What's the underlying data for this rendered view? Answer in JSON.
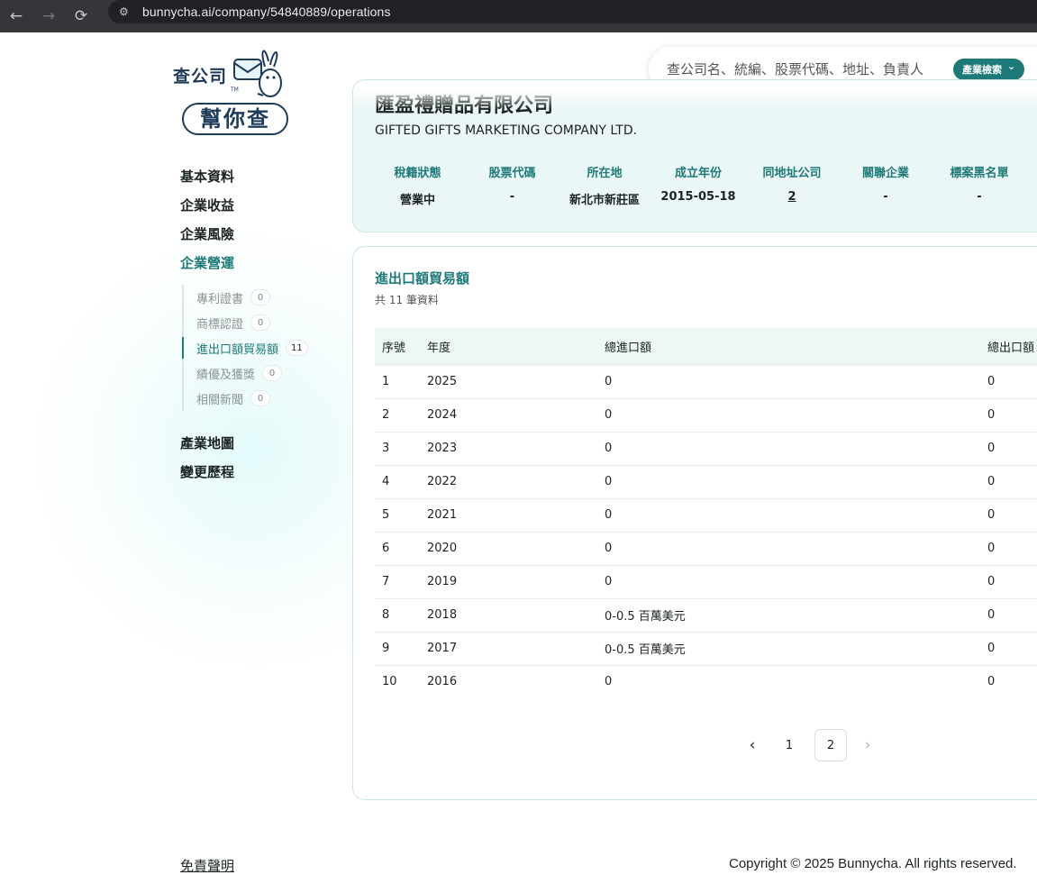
{
  "browser": {
    "url": "bunnycha.ai/company/54840889/operations",
    "back_icon": "←",
    "forward_icon": "→",
    "reload_icon": "⟳",
    "site_icon": "⚙"
  },
  "logo": {
    "wordmark": "查公司",
    "tagline": "幫你查",
    "tm": "TM"
  },
  "search": {
    "placeholder": "查公司名、統編、股票代碼、地址、負責人",
    "type_label": "產業檢索",
    "chevron": "⌄"
  },
  "sidebar": {
    "main_items": [
      {
        "label": "基本資料"
      },
      {
        "label": "企業收益"
      },
      {
        "label": "企業風險"
      },
      {
        "label": "企業營運"
      }
    ],
    "sub_items": [
      {
        "label": "專利證書",
        "count": "0"
      },
      {
        "label": "商標認證",
        "count": "0"
      },
      {
        "label": "進出口額貿易額",
        "count": "11"
      },
      {
        "label": "績優及獲獎",
        "count": "0"
      },
      {
        "label": "相關新聞",
        "count": "0"
      }
    ],
    "bottom_items": [
      {
        "label": "產業地圖"
      },
      {
        "label": "變更歷程"
      }
    ]
  },
  "company": {
    "name": "匯盈禮贈品有限公司",
    "name_en": "GIFTED GIFTS MARKETING COMPANY LTD.",
    "stats": [
      {
        "label": "稅籍狀態",
        "value": "營業中"
      },
      {
        "label": "股票代碼",
        "value": "-"
      },
      {
        "label": "所在地",
        "value": "新北市新莊區"
      },
      {
        "label": "成立年份",
        "value": "2015-05-18"
      },
      {
        "label": "同地址公司",
        "value": "2"
      },
      {
        "label": "關聯企業",
        "value": "-"
      },
      {
        "label": "標案黑名單",
        "value": "-"
      }
    ]
  },
  "trade": {
    "title": "進出口額貿易額",
    "subtitle": "共 11 筆資料",
    "columns": [
      "序號",
      "年度",
      "總進口額",
      "總出口額"
    ],
    "rows": [
      [
        "1",
        "2025",
        "0",
        "0"
      ],
      [
        "2",
        "2024",
        "0",
        "0"
      ],
      [
        "3",
        "2023",
        "0",
        "0"
      ],
      [
        "4",
        "2022",
        "0",
        "0"
      ],
      [
        "5",
        "2021",
        "0",
        "0"
      ],
      [
        "6",
        "2020",
        "0",
        "0"
      ],
      [
        "7",
        "2019",
        "0",
        "0"
      ],
      [
        "8",
        "2018",
        "0-0.5 百萬美元",
        "0"
      ],
      [
        "9",
        "2017",
        "0-0.5 百萬美元",
        "0"
      ],
      [
        "10",
        "2016",
        "0",
        "0"
      ]
    ],
    "pagination": {
      "prev": "‹",
      "next": "›",
      "pages": [
        "1",
        "2"
      ],
      "current": "2"
    }
  },
  "footer": {
    "disclaimer": "免責聲明",
    "copyright": "Copyright © 2025 Bunnycha. All rights reserved."
  }
}
